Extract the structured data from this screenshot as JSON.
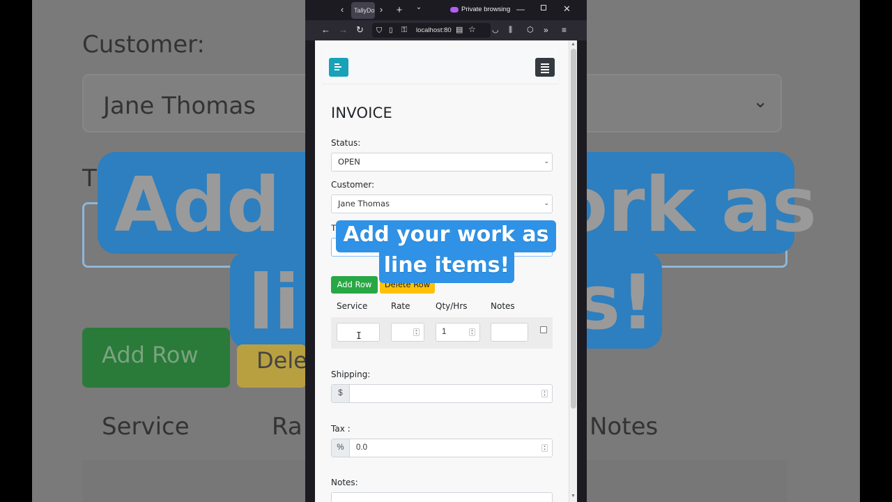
{
  "browser": {
    "tab_title": "TallyDo",
    "private_label": "Private browsing",
    "url": "localhost:80"
  },
  "invoice": {
    "title": "INVOICE",
    "status_label": "Status:",
    "status_value": "OPEN",
    "customer_label": "Customer:",
    "customer_value": "Jane Thomas",
    "truncated_label": "T",
    "add_row": "Add Row",
    "delete_row": "Delete Row",
    "columns": [
      "Service",
      "Rate",
      "Qty/Hrs",
      "Notes"
    ],
    "row": {
      "qty": "1"
    },
    "shipping_label": "Shipping:",
    "shipping_prefix": "$",
    "tax_label": "Tax :",
    "tax_prefix": "%",
    "tax_value": "0.0",
    "notes_label": "Notes:"
  },
  "caption": {
    "line1": "Add your work as",
    "line2": "line items!"
  },
  "background": {
    "customer_label": "Customer:",
    "customer_value": "Jane Thomas",
    "t": "T",
    "banner_left": "Add y",
    "banner_right": "ork as",
    "banner_bottom_left": "li",
    "banner_bottom_right": "s!",
    "add_row": "Add Row",
    "delete_fragment": "Dele",
    "col_service": "Service",
    "col_rate": "Ra",
    "col_notes": "Notes"
  }
}
